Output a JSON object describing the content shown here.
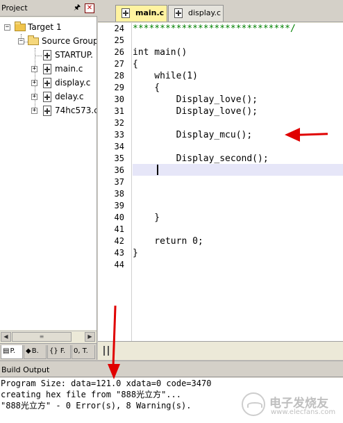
{
  "project_panel": {
    "title": "Project",
    "pin_glyph": "█",
    "close_glyph": "✕",
    "tree": {
      "target": "Target 1",
      "group": "Source Group",
      "files": [
        "STARTUP.",
        "main.c",
        "display.c",
        "delay.c",
        "74hc573.c"
      ]
    },
    "tabs": [
      "P.",
      "B.",
      "{} F.",
      "0, T."
    ]
  },
  "editor": {
    "tabs": [
      "main.c",
      "display.c"
    ],
    "active_tab": "main.c",
    "line_numbers": [
      "24",
      "25",
      "26",
      "27",
      "28",
      "29",
      "30",
      "31",
      "32",
      "33",
      "34",
      "35",
      "36",
      "37",
      "38",
      "39",
      "40",
      "41",
      "42",
      "43",
      "44"
    ],
    "code_lines": [
      "*****************************/",
      "",
      "int main()",
      "{",
      "    while(1)",
      "    {",
      "        Display_love();",
      "        Display_love();",
      "",
      "        Display_mcu();",
      "",
      "        Display_second();",
      "",
      "",
      "",
      "",
      "    }",
      "",
      "    return 0;",
      "}",
      ""
    ],
    "current_line": "36"
  },
  "build_output": {
    "title": "Build Output",
    "lines": [
      "Program Size: data=121.0 xdata=0 code=3470",
      "creating hex file from \"888光立方\"...",
      "\"888光立方\" - 0 Error(s), 8 Warning(s)."
    ]
  },
  "watermark": {
    "name": "电子发烧友",
    "url": "www.elecfans.com"
  },
  "colors": {
    "panel_bg": "#d4d0c8",
    "active_tab_bg": "#fff3a0",
    "annotation_arrow": "#e00000",
    "current_line_bg": "#e6e6f8"
  }
}
